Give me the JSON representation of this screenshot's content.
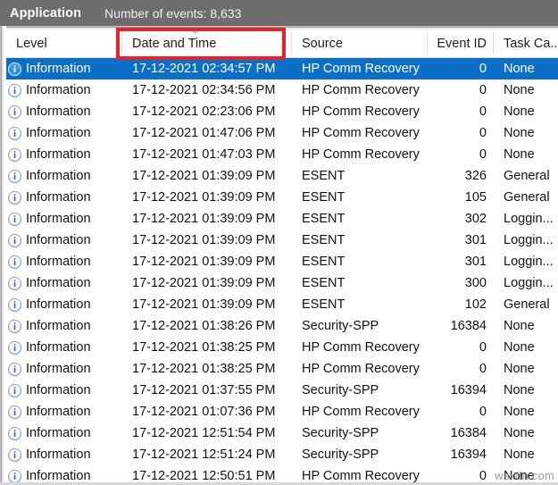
{
  "header": {
    "log_name": "Application",
    "event_count_label": "Number of events: 8,633"
  },
  "columns": [
    {
      "id": "level",
      "label": "Level",
      "width": 130,
      "align": "left"
    },
    {
      "id": "datetime",
      "label": "Date and Time",
      "width": 190,
      "align": "left"
    },
    {
      "id": "source",
      "label": "Source",
      "width": 152,
      "align": "left"
    },
    {
      "id": "eventid",
      "label": "Event ID",
      "width": 74,
      "align": "right"
    },
    {
      "id": "taskcat",
      "label": "Task Ca...",
      "width": 72,
      "align": "left"
    }
  ],
  "sort": {
    "column": "datetime",
    "indicator_icon": "chevron-up-sort-icon"
  },
  "annotation": {
    "type": "red-rectangle",
    "target_column": "Date and Time",
    "color": "#e8212a"
  },
  "selection": {
    "selected_row_index": 0,
    "highlight_color": "#0b6fc8"
  },
  "row_icon": "information-icon",
  "rows": [
    {
      "level": "Information",
      "datetime": "17-12-2021 02:34:57 PM",
      "source": "HP Comm Recovery",
      "eventid": "0",
      "taskcat": "None"
    },
    {
      "level": "Information",
      "datetime": "17-12-2021 02:34:56 PM",
      "source": "HP Comm Recovery",
      "eventid": "0",
      "taskcat": "None"
    },
    {
      "level": "Information",
      "datetime": "17-12-2021 02:23:06 PM",
      "source": "HP Comm Recovery",
      "eventid": "0",
      "taskcat": "None"
    },
    {
      "level": "Information",
      "datetime": "17-12-2021 01:47:06 PM",
      "source": "HP Comm Recovery",
      "eventid": "0",
      "taskcat": "None"
    },
    {
      "level": "Information",
      "datetime": "17-12-2021 01:47:03 PM",
      "source": "HP Comm Recovery",
      "eventid": "0",
      "taskcat": "None"
    },
    {
      "level": "Information",
      "datetime": "17-12-2021 01:39:09 PM",
      "source": "ESENT",
      "eventid": "326",
      "taskcat": "General"
    },
    {
      "level": "Information",
      "datetime": "17-12-2021 01:39:09 PM",
      "source": "ESENT",
      "eventid": "105",
      "taskcat": "General"
    },
    {
      "level": "Information",
      "datetime": "17-12-2021 01:39:09 PM",
      "source": "ESENT",
      "eventid": "302",
      "taskcat": "Loggin..."
    },
    {
      "level": "Information",
      "datetime": "17-12-2021 01:39:09 PM",
      "source": "ESENT",
      "eventid": "301",
      "taskcat": "Loggin..."
    },
    {
      "level": "Information",
      "datetime": "17-12-2021 01:39:09 PM",
      "source": "ESENT",
      "eventid": "301",
      "taskcat": "Loggin..."
    },
    {
      "level": "Information",
      "datetime": "17-12-2021 01:39:09 PM",
      "source": "ESENT",
      "eventid": "300",
      "taskcat": "Loggin..."
    },
    {
      "level": "Information",
      "datetime": "17-12-2021 01:39:09 PM",
      "source": "ESENT",
      "eventid": "102",
      "taskcat": "General"
    },
    {
      "level": "Information",
      "datetime": "17-12-2021 01:38:26 PM",
      "source": "Security-SPP",
      "eventid": "16384",
      "taskcat": "None"
    },
    {
      "level": "Information",
      "datetime": "17-12-2021 01:38:25 PM",
      "source": "HP Comm Recovery",
      "eventid": "0",
      "taskcat": "None"
    },
    {
      "level": "Information",
      "datetime": "17-12-2021 01:38:25 PM",
      "source": "HP Comm Recovery",
      "eventid": "0",
      "taskcat": "None"
    },
    {
      "level": "Information",
      "datetime": "17-12-2021 01:37:55 PM",
      "source": "Security-SPP",
      "eventid": "16394",
      "taskcat": "None"
    },
    {
      "level": "Information",
      "datetime": "17-12-2021 01:07:36 PM",
      "source": "HP Comm Recovery",
      "eventid": "0",
      "taskcat": "None"
    },
    {
      "level": "Information",
      "datetime": "17-12-2021 12:51:54 PM",
      "source": "Security-SPP",
      "eventid": "16384",
      "taskcat": "None"
    },
    {
      "level": "Information",
      "datetime": "17-12-2021 12:51:24 PM",
      "source": "Security-SPP",
      "eventid": "16394",
      "taskcat": "None"
    },
    {
      "level": "Information",
      "datetime": "17-12-2021 12:50:51 PM",
      "source": "HP Comm Recovery",
      "eventid": "0",
      "taskcat": "None"
    }
  ],
  "watermark": {
    "text": "wsxdn.com"
  }
}
